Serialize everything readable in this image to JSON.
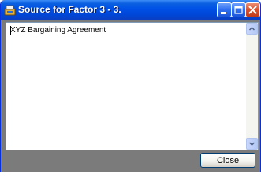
{
  "window": {
    "title": "Source for Factor 3 - 3.",
    "accent_color": "#0054e3",
    "close_accent_color": "#d9522d"
  },
  "title_buttons": {
    "minimize_icon": "minimize-icon",
    "maximize_icon": "maximize-icon",
    "close_icon": "close-icon"
  },
  "textarea": {
    "value": "XYZ Bargaining Agreement"
  },
  "scrollbar": {
    "up_icon": "arrow-up-icon",
    "down_icon": "arrow-down-icon"
  },
  "footer": {
    "close_label": "Close"
  }
}
